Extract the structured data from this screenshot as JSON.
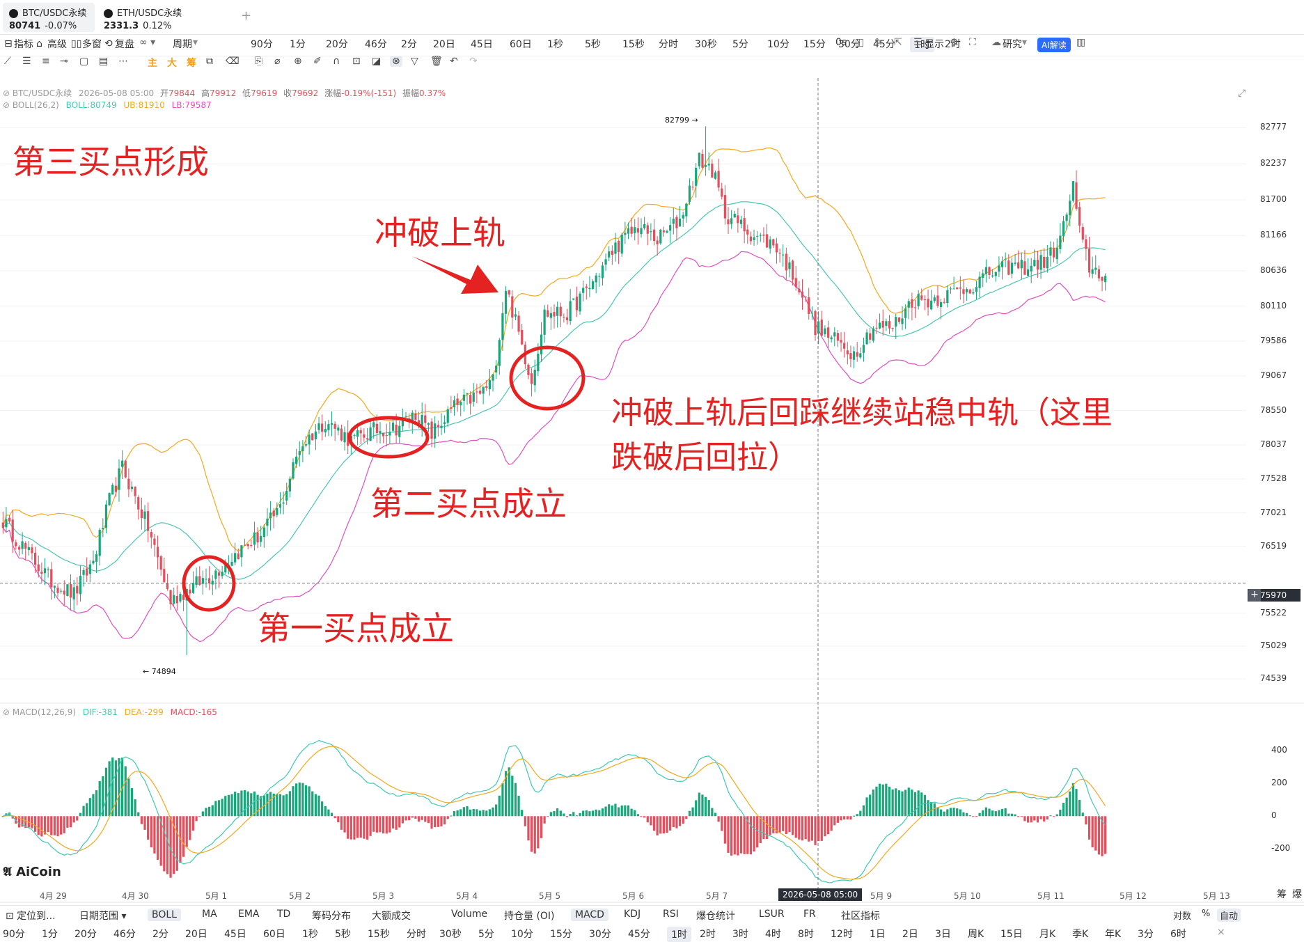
{
  "tabs": [
    {
      "name": "BTC/USDC永续",
      "price": "80741",
      "change": "-0.07%"
    },
    {
      "name": "ETH/USDC永续",
      "price": "2331.3",
      "change": "0.12%"
    }
  ],
  "add_tab": "+",
  "toolbar": {
    "left": [
      "指标",
      "高级",
      "多窗",
      "复盘"
    ],
    "period_label": "周期",
    "intervals": [
      "90分",
      "1分",
      "20分",
      "46分",
      "2分",
      "20日",
      "45日",
      "60日",
      "1秒",
      "5秒",
      "15秒",
      "分时",
      "30秒",
      "5分",
      "10分",
      "15分",
      "30分",
      "45分",
      "1时",
      "2时"
    ],
    "active_interval": "1时",
    "right": [
      "0s",
      "显示",
      "研究",
      "AI解读"
    ]
  },
  "draw_toolbar": {
    "quick": [
      "主",
      "大",
      "筹"
    ]
  },
  "legend": {
    "symbol": "BTC/USDC永续",
    "time": "2026-05-08 05:00",
    "open_lbl": "开",
    "open": "79844",
    "high_lbl": "高",
    "high": "79912",
    "low_lbl": "低",
    "low": "79619",
    "close_lbl": "收",
    "close": "79692",
    "chg_lbl": "涨幅",
    "chg": "-0.19%(-151)",
    "amp_lbl": "振幅",
    "amp": "0.37%",
    "boll": "BOLL(26,2)",
    "boll_mid": "BOLL:80749",
    "boll_ub": "UB:81910",
    "boll_lb": "LB:79587",
    "macd": "MACD(12,26,9)",
    "dif": "DIF:-381",
    "dea": "DEA:-299",
    "macd_v": "MACD:-165"
  },
  "annotations": {
    "a1": "第三买点形成",
    "a2": "冲破上轨",
    "a3": "冲破上轨后回踩继续站稳中轨（这里",
    "a3b": "跌破后回拉）",
    "a4": "第二买点成立",
    "a5": "第一买点成立"
  },
  "price_markers": {
    "high": "82799 →",
    "low": "← 74894"
  },
  "crosshair": {
    "price": "75970",
    "time": "2026-05-08 05:00"
  },
  "watermark": "AiCoin",
  "colors": {
    "up": "#19a67a",
    "down": "#e34f5c",
    "ub": "#f2a81f",
    "mid": "#4bc4b6",
    "lb": "#de4fbf",
    "dif": "#3fc8b5",
    "dea": "#f2a81f",
    "annot": "#e52222"
  },
  "bottom_bar1": [
    "定位到...",
    "日期范围",
    "BOLL",
    "MA",
    "EMA",
    "TD",
    "筹码分布",
    "大额成交",
    "Volume",
    "持仓量 (OI)",
    "MACD",
    "KDJ",
    "RSI",
    "爆仓统计",
    "LSUR",
    "FR",
    "社区指标"
  ],
  "bottom_bar1_right": [
    "对数",
    "%",
    "自动"
  ],
  "bottom_bar2": [
    "90分",
    "1分",
    "20分",
    "46分",
    "2分",
    "20日",
    "45日",
    "60日",
    "1秒",
    "5秒",
    "15秒",
    "分时",
    "30秒",
    "5分",
    "10分",
    "15分",
    "30分",
    "45分",
    "1时",
    "2时",
    "3时",
    "4时",
    "8时",
    "12时",
    "1日",
    "2日",
    "3日",
    "周K",
    "15日",
    "月K",
    "季K",
    "年K",
    "3分",
    "6时"
  ],
  "bottom_bar2_active": "1时",
  "right_labels": [
    "筹",
    "爆"
  ],
  "chart_data": {
    "type": "candlestick",
    "symbol": "BTC/USDC永续",
    "interval": "1h",
    "y_ticks": [
      82777,
      82237,
      81700,
      81166,
      80636,
      80110,
      79586,
      79067,
      78550,
      78037,
      77528,
      77021,
      76519,
      75522,
      75029,
      74539
    ],
    "macd_ticks": [
      400,
      200,
      0,
      -200
    ],
    "x_ticks": [
      "4月 29",
      "4月 30",
      "5月 1",
      "5月 2",
      "5月 3",
      "5月 4",
      "5月 5",
      "5月 6",
      "5月 7",
      "5月 9",
      "5月 10",
      "5月 11",
      "5月 12",
      "5月 13"
    ],
    "ylim": [
      74300,
      83000
    ],
    "macd_ylim": [
      -380,
      560
    ],
    "anchors": [
      {
        "i": 0,
        "p": 76900
      },
      {
        "i": 8,
        "p": 76400
      },
      {
        "i": 15,
        "p": 76000
      },
      {
        "i": 22,
        "p": 75800
      },
      {
        "i": 28,
        "p": 76300
      },
      {
        "i": 33,
        "p": 77200
      },
      {
        "i": 37,
        "p": 77700
      },
      {
        "i": 45,
        "p": 76800
      },
      {
        "i": 52,
        "p": 75700
      },
      {
        "i": 58,
        "p": 75900
      },
      {
        "i": 65,
        "p": 76100
      },
      {
        "i": 72,
        "p": 76400
      },
      {
        "i": 80,
        "p": 76700
      },
      {
        "i": 86,
        "p": 77100
      },
      {
        "i": 92,
        "p": 78000
      },
      {
        "i": 100,
        "p": 78400
      },
      {
        "i": 108,
        "p": 78100
      },
      {
        "i": 115,
        "p": 78250
      },
      {
        "i": 122,
        "p": 78300
      },
      {
        "i": 128,
        "p": 78500
      },
      {
        "i": 133,
        "p": 78200
      },
      {
        "i": 140,
        "p": 78600
      },
      {
        "i": 148,
        "p": 78800
      },
      {
        "i": 152,
        "p": 79000
      },
      {
        "i": 156,
        "p": 80400
      },
      {
        "i": 160,
        "p": 79700
      },
      {
        "i": 164,
        "p": 79000
      },
      {
        "i": 168,
        "p": 80000
      },
      {
        "i": 175,
        "p": 80000
      },
      {
        "i": 182,
        "p": 80400
      },
      {
        "i": 190,
        "p": 81000
      },
      {
        "i": 197,
        "p": 81300
      },
      {
        "i": 203,
        "p": 81100
      },
      {
        "i": 210,
        "p": 81400
      },
      {
        "i": 216,
        "p": 82300
      },
      {
        "i": 220,
        "p": 82150
      },
      {
        "i": 224,
        "p": 81500
      },
      {
        "i": 232,
        "p": 81200
      },
      {
        "i": 240,
        "p": 81000
      },
      {
        "i": 246,
        "p": 80500
      },
      {
        "i": 252,
        "p": 79800
      },
      {
        "i": 258,
        "p": 79600
      },
      {
        "i": 264,
        "p": 79400
      },
      {
        "i": 270,
        "p": 79800
      },
      {
        "i": 276,
        "p": 79800
      },
      {
        "i": 282,
        "p": 80200
      },
      {
        "i": 288,
        "p": 80200
      },
      {
        "i": 294,
        "p": 80300
      },
      {
        "i": 300,
        "p": 80400
      },
      {
        "i": 306,
        "p": 80600
      },
      {
        "i": 312,
        "p": 80700
      },
      {
        "i": 318,
        "p": 80700
      },
      {
        "i": 324,
        "p": 80800
      },
      {
        "i": 328,
        "p": 81100
      },
      {
        "i": 332,
        "p": 81900
      },
      {
        "i": 334,
        "p": 81200
      },
      {
        "i": 337,
        "p": 80700
      },
      {
        "i": 342,
        "p": 80550
      }
    ],
    "bars": 343,
    "boll_period": 26,
    "boll_k": 2,
    "macd_params": [
      12,
      26,
      9
    ]
  }
}
